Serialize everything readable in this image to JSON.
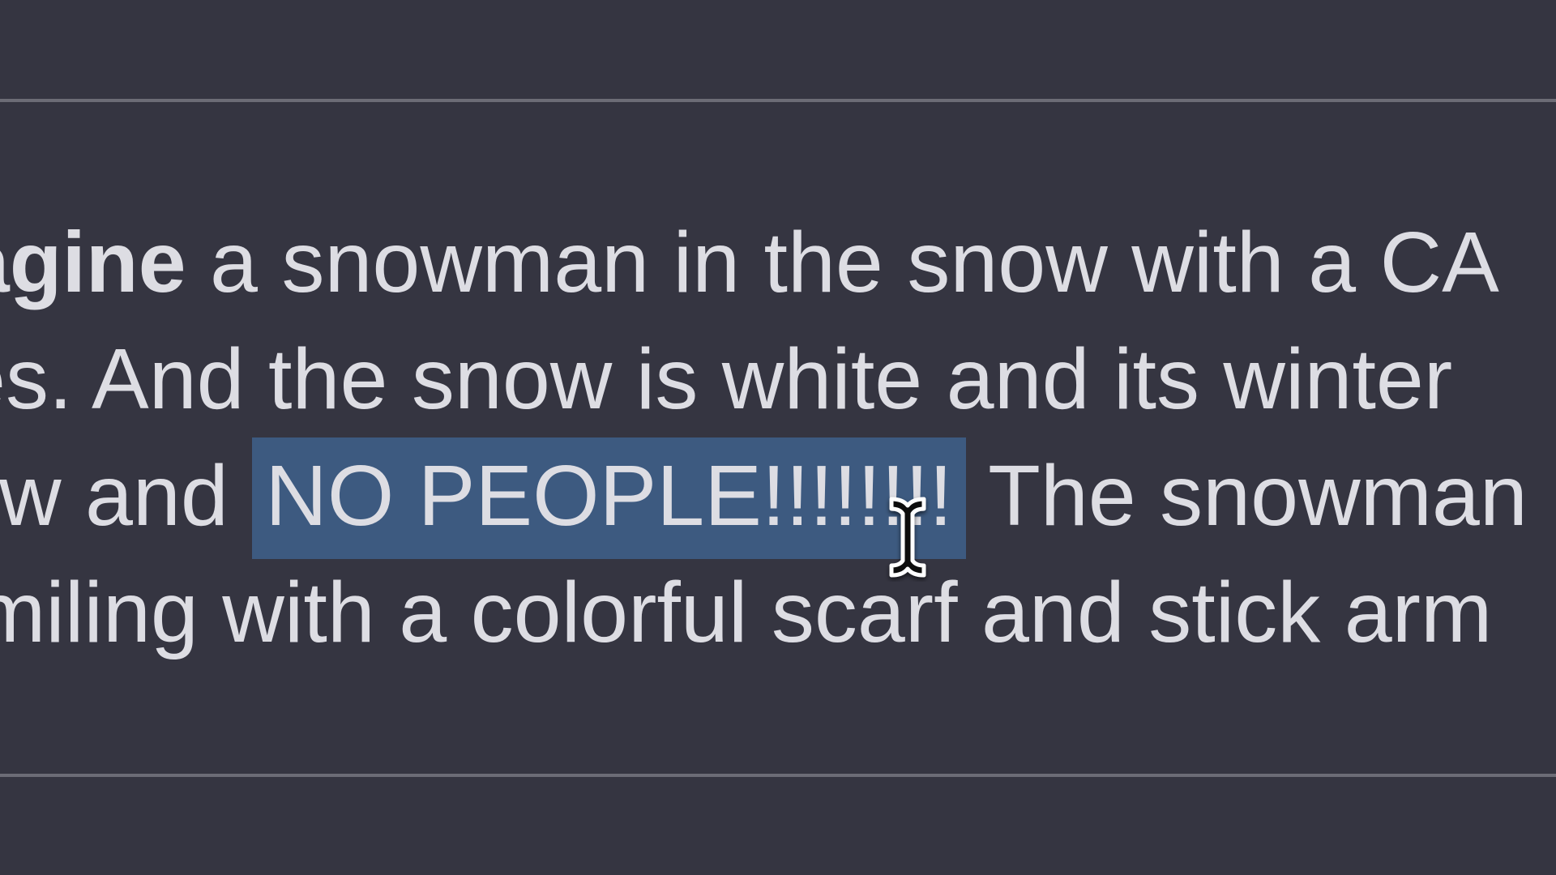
{
  "message": {
    "line1": {
      "bold_word": "nagine",
      "rest": " a snowman in the snow with a CA"
    },
    "line2": {
      "text": "es. And the snow is white and its winter"
    },
    "line3": {
      "before": "ow and ",
      "selected": "NO PEOPLE!!!!!!!!",
      "after": " The snowman"
    },
    "line4": {
      "text": "miling with a colorful scarf and stick arm"
    }
  },
  "cursor": {
    "icon": "text-ibeam-cursor-icon"
  },
  "colors": {
    "background": "#353541",
    "text": "#dddde3",
    "selection": "#3d5a80",
    "divider": "#6c6c76"
  }
}
